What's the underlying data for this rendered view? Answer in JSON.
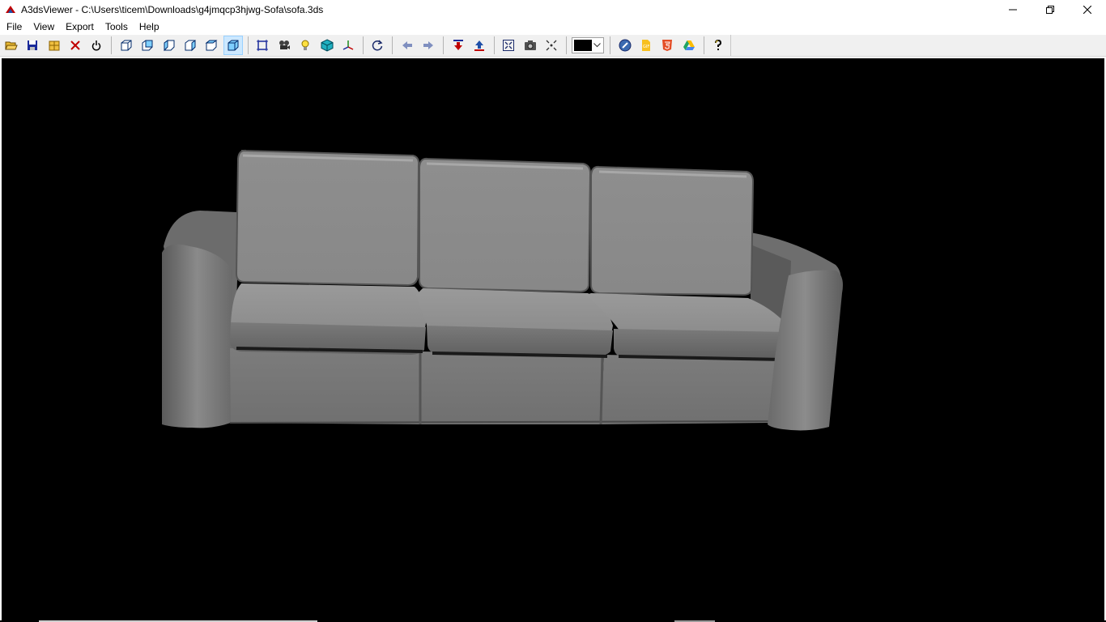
{
  "window": {
    "title": "A3dsViewer - C:\\Users\\ticem\\Downloads\\g4jmqcp3hjwg-Sofa\\sofa.3ds",
    "controls": [
      "minimize-icon",
      "restore-icon",
      "close-icon"
    ]
  },
  "menu": {
    "items": [
      {
        "label": "File"
      },
      {
        "label": "View"
      },
      {
        "label": "Export"
      },
      {
        "label": "Tools"
      },
      {
        "label": "Help"
      }
    ]
  },
  "toolbar": {
    "groups": [
      [
        "open-folder-icon",
        "save-icon",
        "merge-icon",
        "close-model-icon",
        "power-icon"
      ],
      [
        "view-front-icon",
        "view-back-icon",
        "view-left-icon",
        "view-right-icon",
        "view-top-icon",
        "view-perspective-icon"
      ],
      [
        "bounding-box-icon",
        "camera-settings-icon",
        "light-icon",
        "cube-material-icon",
        "axes-icon"
      ],
      [
        "rotate-icon"
      ],
      [
        "arrow-left-icon",
        "arrow-right-icon"
      ],
      [
        "move-down-icon",
        "move-up-icon"
      ],
      [
        "fit-to-window-icon",
        "screenshot-camera-icon",
        "center-icon"
      ],
      [
        "background-color-select"
      ],
      [
        "web-export-icon",
        "gif-export-icon",
        "html5-export-icon",
        "google-drive-icon"
      ],
      [
        "help-icon"
      ]
    ],
    "active_view": "view-perspective-icon",
    "background_color": "#000000"
  },
  "viewport": {
    "background": "#000000",
    "model": "sofa-3d-model",
    "model_color": "#8c8c8c"
  },
  "colors": {
    "toolbar_bg": "#f0f0f0",
    "active_highlight": "#cce8ff",
    "arrow_blue": "#7f8fbf",
    "move_red": "#c00000",
    "move_blue": "#1f4fa8"
  }
}
